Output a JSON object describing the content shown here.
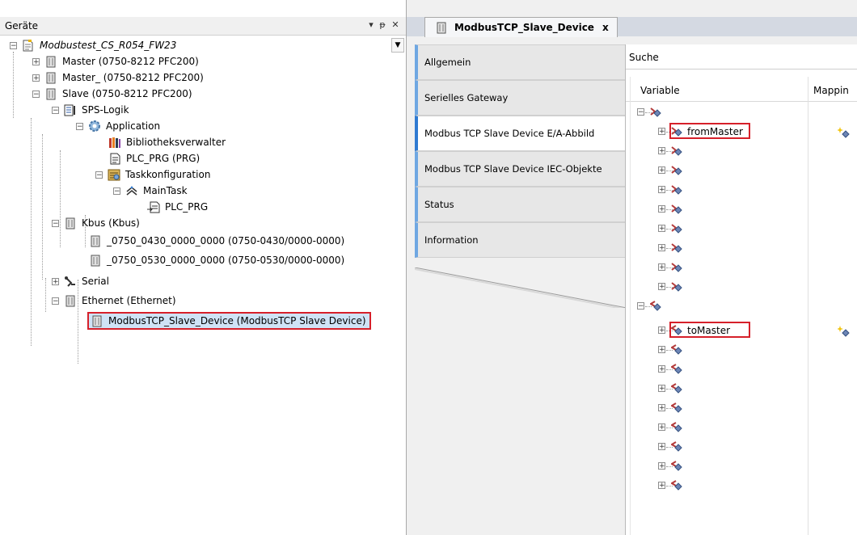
{
  "devices_panel": {
    "title": "Geräte",
    "pin_icon": "pin-icon",
    "close_icon": "close-icon",
    "tree": [
      {
        "label": "Modbustest_CS_R054_FW23",
        "italic": true,
        "icon": "project-icon"
      },
      {
        "label": "Master (0750-8212 PFC200)",
        "icon": "device-icon"
      },
      {
        "label": "Master_ (0750-8212 PFC200)",
        "icon": "device-icon"
      },
      {
        "label": "Slave (0750-8212 PFC200)",
        "icon": "device-icon"
      },
      {
        "label": "SPS-Logik",
        "icon": "plc-logic-icon"
      },
      {
        "label": "Application",
        "icon": "application-gear-icon"
      },
      {
        "label": "Bibliotheksverwalter",
        "icon": "library-icon"
      },
      {
        "label": "PLC_PRG (PRG)",
        "icon": "pou-icon"
      },
      {
        "label": "Taskkonfiguration",
        "icon": "task-config-icon"
      },
      {
        "label": "MainTask",
        "icon": "task-icon"
      },
      {
        "label": "PLC_PRG",
        "icon": "program-call-icon"
      },
      {
        "label": "Kbus (Kbus)",
        "icon": "device-icon"
      },
      {
        "label": "_0750_0430_0000_0000 (0750-0430/0000-0000)",
        "icon": "device-icon"
      },
      {
        "label": "_0750_0530_0000_0000 (0750-0530/0000-0000)",
        "icon": "device-icon"
      },
      {
        "label": "Serial",
        "icon": "serial-icon"
      },
      {
        "label": "Ethernet (Ethernet)",
        "icon": "device-icon"
      },
      {
        "label": "ModbusTCP_Slave_Device (ModbusTCP Slave Device)",
        "icon": "device-icon",
        "selected": true
      }
    ]
  },
  "editor": {
    "tab_title": "ModbusTCP_Slave_Device",
    "tab_close": "x",
    "side_tabs": [
      {
        "label": "Allgemein"
      },
      {
        "label": "Serielles Gateway"
      },
      {
        "label": "Modbus TCP Slave Device E/A-Abbild",
        "active": true
      },
      {
        "label": "Modbus TCP Slave Device IEC-Objekte"
      },
      {
        "label": "Status"
      },
      {
        "label": "Information"
      }
    ],
    "search_label": "Suche",
    "columns": {
      "variable": "Variable",
      "mapping": "Mappin"
    },
    "rows_from_master": {
      "label": "fromMaster"
    },
    "rows_to_master": {
      "label": "toMaster"
    }
  },
  "colors": {
    "highlight_red": "#d6202a",
    "selection_blue": "#cfe3f6",
    "tab_accent": "#2f7ad1"
  }
}
